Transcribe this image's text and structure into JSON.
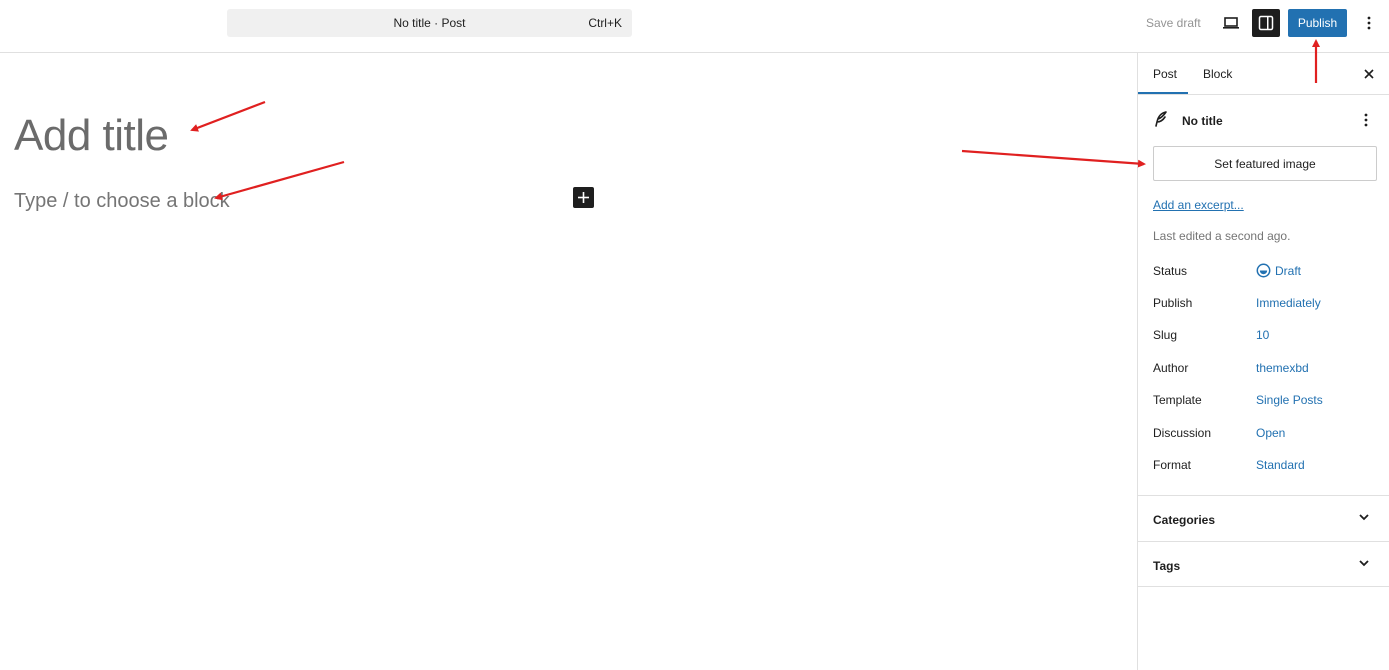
{
  "topbar": {
    "command_title": "No title · Post",
    "command_shortcut": "Ctrl+K",
    "save_draft": "Save draft",
    "publish": "Publish",
    "icons": {
      "view": "laptop-icon",
      "settings": "sidebar-toggle-icon",
      "more": "more-vertical-icon"
    }
  },
  "editor": {
    "title_placeholder": "Add title",
    "block_placeholder": "Type / to choose a block",
    "add_block_icon": "plus-icon"
  },
  "sidebar": {
    "tabs": [
      {
        "label": "Post",
        "active": true
      },
      {
        "label": "Block",
        "active": false
      }
    ],
    "post_name": "No title",
    "featured_image_button": "Set featured image",
    "excerpt_link": "Add an excerpt...",
    "last_edited": "Last edited a second ago.",
    "properties": [
      {
        "label": "Status",
        "value": "Draft"
      },
      {
        "label": "Publish",
        "value": "Immediately"
      },
      {
        "label": "Slug",
        "value": "10"
      },
      {
        "label": "Author",
        "value": "themexbd"
      },
      {
        "label": "Template",
        "value": "Single Posts"
      },
      {
        "label": "Discussion",
        "value": "Open"
      },
      {
        "label": "Format",
        "value": "Standard"
      }
    ],
    "sections": [
      {
        "label": "Categories"
      },
      {
        "label": "Tags"
      }
    ]
  },
  "colors": {
    "accent": "#2271b1",
    "annotation_arrow": "#e02020",
    "border": "#e0e0e0"
  }
}
